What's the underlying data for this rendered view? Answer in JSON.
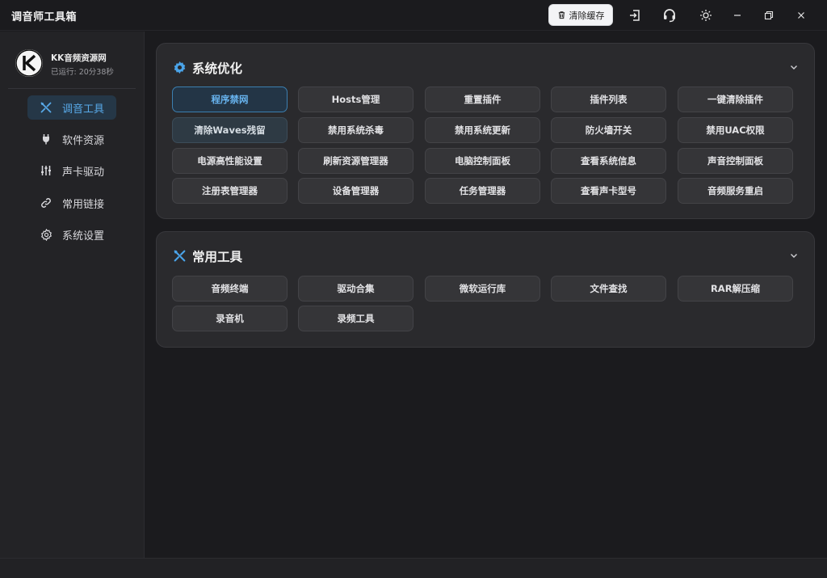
{
  "app": {
    "title": "调音师工具箱",
    "clear_cache_label": "清除缓存",
    "accent_color": "#4aa3e8"
  },
  "titlebar_icons": [
    "logout-icon",
    "headset-icon",
    "theme-sun-icon",
    "minimize-icon",
    "restore-icon",
    "close-icon"
  ],
  "profile": {
    "name": "KK音频资源网",
    "status": "已运行: 20分38秒"
  },
  "sidebar": {
    "items": [
      {
        "label": "调音工具",
        "icon": "tools-icon",
        "active": true
      },
      {
        "label": "软件资源",
        "icon": "plug-icon",
        "active": false
      },
      {
        "label": "声卡驱动",
        "icon": "sliders-icon",
        "active": false
      },
      {
        "label": "常用链接",
        "icon": "link-icon",
        "active": false
      },
      {
        "label": "系统设置",
        "icon": "gear-icon",
        "active": false
      }
    ]
  },
  "sections": [
    {
      "title": "系统优化",
      "icon": "gear-icon",
      "buttons": [
        "程序禁网",
        "Hosts管理",
        "重置插件",
        "插件列表",
        "一键清除插件",
        "清除Waves残留",
        "禁用系统杀毒",
        "禁用系统更新",
        "防火墙开关",
        "禁用UAC权限",
        "电源高性能设置",
        "刷新资源管理器",
        "电脑控制面板",
        "查看系统信息",
        "声音控制面板",
        "注册表管理器",
        "设备管理器",
        "任务管理器",
        "查看声卡型号",
        "音频服务重启"
      ]
    },
    {
      "title": "常用工具",
      "icon": "tools-icon",
      "buttons": [
        "音频终端",
        "驱动合集",
        "微软运行库",
        "文件查找",
        "RAR解压缩",
        "录音机",
        "录频工具"
      ]
    }
  ]
}
